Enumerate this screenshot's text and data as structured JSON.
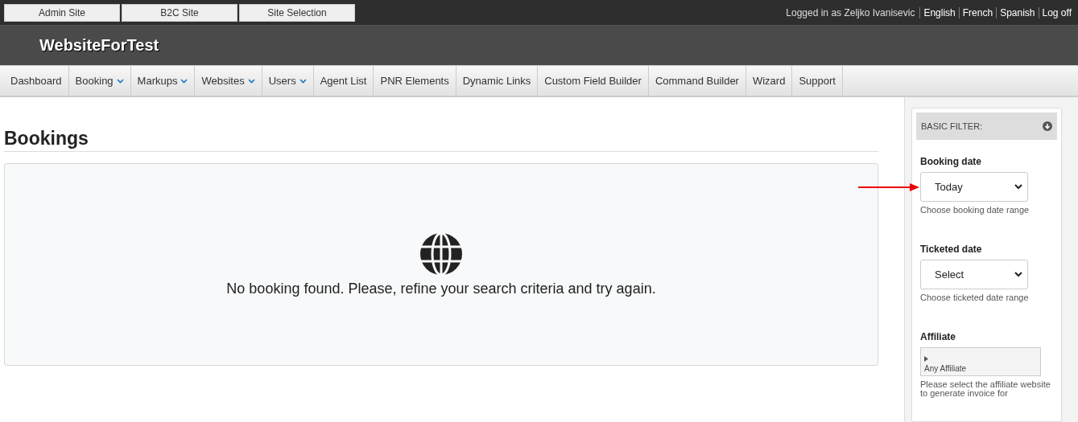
{
  "top_bar": {
    "site_buttons": [
      "Admin Site",
      "B2C Site",
      "Site Selection"
    ],
    "user_text": "Logged in as Zeljko Ivanisevic",
    "links": [
      "English",
      "French",
      "Spanish",
      "Log off"
    ]
  },
  "header": {
    "title": "WebsiteForTest"
  },
  "nav": [
    {
      "label": "Dashboard",
      "dropdown": false
    },
    {
      "label": "Booking",
      "dropdown": true
    },
    {
      "label": "Markups",
      "dropdown": true
    },
    {
      "label": "Websites",
      "dropdown": true
    },
    {
      "label": "Users",
      "dropdown": true
    },
    {
      "label": "Agent List",
      "dropdown": false
    },
    {
      "label": "PNR Elements",
      "dropdown": false
    },
    {
      "label": "Dynamic Links",
      "dropdown": false
    },
    {
      "label": "Custom Field Builder",
      "dropdown": false
    },
    {
      "label": "Command Builder",
      "dropdown": false
    },
    {
      "label": "Wizard",
      "dropdown": false
    },
    {
      "label": "Support",
      "dropdown": false
    }
  ],
  "page": {
    "title": "Bookings",
    "empty_message": "No booking found. Please, refine your search criteria and try again."
  },
  "filter": {
    "title": "BASIC FILTER:",
    "fields": [
      {
        "kind": "select",
        "label": "Booking date",
        "value": "Today",
        "help": "Choose booking date range",
        "annotated": true
      },
      {
        "kind": "select",
        "label": "Ticketed date",
        "value": "Select",
        "help": "Choose ticketed date range",
        "annotated": false
      },
      {
        "kind": "list",
        "label": "Affiliate",
        "value": "Any Affiliate",
        "help": "Please select the affiliate website to generate invoice for",
        "annotated": false
      }
    ]
  }
}
